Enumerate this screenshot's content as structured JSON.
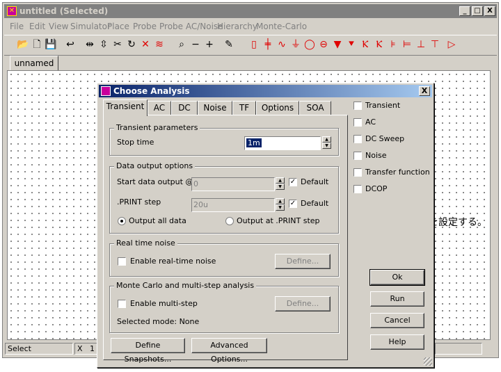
{
  "window": {
    "title": "untitled (Selected)",
    "controls": [
      "_",
      "□",
      "X"
    ]
  },
  "menu": [
    "File",
    "Edit",
    "View",
    "Simulator",
    "Place",
    "Probe",
    "Probe AC/Noise",
    "Hierarchy",
    "Monte-Carlo"
  ],
  "toolbar": [
    {
      "icon": "open-folder-icon",
      "glyph": "📂",
      "red": false
    },
    {
      "icon": "new-file-icon",
      "glyph": "🗋",
      "red": false
    },
    {
      "icon": "save-icon",
      "glyph": "💾",
      "red": false
    },
    {
      "icon": "undo-icon",
      "glyph": "↩",
      "red": false
    },
    {
      "icon": "flip-horizontal-icon",
      "glyph": "⇹",
      "red": false
    },
    {
      "icon": "flip-vertical-icon",
      "glyph": "⇳",
      "red": false
    },
    {
      "icon": "cut-icon",
      "glyph": "✂",
      "red": false
    },
    {
      "icon": "rotate-icon",
      "glyph": "↻",
      "red": false
    },
    {
      "icon": "delete-wire-icon",
      "glyph": "✕",
      "red": true
    },
    {
      "icon": "bus-icon",
      "glyph": "≋",
      "red": true
    },
    {
      "icon": "zoom-fit-icon",
      "glyph": "⌕",
      "red": false
    },
    {
      "icon": "zoom-out-icon",
      "glyph": "−",
      "red": false
    },
    {
      "icon": "zoom-in-icon",
      "glyph": "+",
      "red": false
    },
    {
      "icon": "wire-pencil-icon",
      "glyph": "✎",
      "red": false
    },
    {
      "icon": "resistor-icon",
      "glyph": "▯",
      "red": true
    },
    {
      "icon": "capacitor-icon",
      "glyph": "╪",
      "red": true
    },
    {
      "icon": "inductor-icon",
      "glyph": "∿",
      "red": true
    },
    {
      "icon": "ground-icon",
      "glyph": "⏚",
      "red": true
    },
    {
      "icon": "voltage-source-icon",
      "glyph": "◯",
      "red": true
    },
    {
      "icon": "current-source-icon",
      "glyph": "⊖",
      "red": true
    },
    {
      "icon": "diode-icon",
      "glyph": "▼",
      "red": true
    },
    {
      "icon": "zener-icon",
      "glyph": "⯆",
      "red": true
    },
    {
      "icon": "npn-transistor-icon",
      "glyph": "Ⲕ",
      "red": true
    },
    {
      "icon": "pnp-transistor-icon",
      "glyph": "Ⲕ",
      "red": true
    },
    {
      "icon": "nmos-icon",
      "glyph": "⊧",
      "red": true
    },
    {
      "icon": "pmos-icon",
      "glyph": "⊨",
      "red": true
    },
    {
      "icon": "njfet-icon",
      "glyph": "⊥",
      "red": true
    },
    {
      "icon": "pjfet-icon",
      "glyph": "⊤",
      "red": true
    },
    {
      "icon": "opamp-icon",
      "glyph": "▷",
      "red": true
    }
  ],
  "document_tab": "unnamed",
  "canvas_text": "を設定する。",
  "statusbar": {
    "mode": "Select",
    "x_label": "X",
    "x_value": "1"
  },
  "dialog": {
    "title": "Choose Analysis",
    "close": "X",
    "tabs": [
      "Transient",
      "AC",
      "DC",
      "Noise",
      "TF",
      "Options",
      "SOA"
    ],
    "active_tab": "Transient",
    "transient_parameters": {
      "title": "Transient parameters",
      "stop_time_label": "Stop time",
      "stop_time_value": "1m"
    },
    "data_output": {
      "title": "Data output options",
      "start_label": "Start data output @",
      "start_value": "0",
      "start_default_label": "Default",
      "start_default_checked": true,
      "print_step_label": ".PRINT step",
      "print_step_value": "20u",
      "print_default_label": "Default",
      "print_default_checked": true,
      "output_all_label": "Output all data",
      "output_all_selected": true,
      "output_at_print_label": "Output at .PRINT step",
      "output_at_print_selected": false
    },
    "real_time_noise": {
      "title": "Real time noise",
      "enable_label": "Enable real-time noise",
      "enabled": false,
      "define_label": "Define..."
    },
    "monte_carlo": {
      "title": "Monte Carlo and multi-step analysis",
      "enable_label": "Enable multi-step",
      "enabled": false,
      "define_label": "Define...",
      "selected_mode": "Selected mode: None"
    },
    "define_snapshots_label": "Define Snapshots...",
    "advanced_options_label": "Advanced Options...",
    "analysis_checks": [
      {
        "label": "Transient",
        "checked": false
      },
      {
        "label": "AC",
        "checked": false
      },
      {
        "label": "DC Sweep",
        "checked": false
      },
      {
        "label": "Noise",
        "checked": false
      },
      {
        "label": "Transfer function",
        "checked": false
      },
      {
        "label": "DCOP",
        "checked": false
      }
    ],
    "buttons": {
      "ok": "Ok",
      "run": "Run",
      "cancel": "Cancel",
      "help": "Help"
    }
  }
}
